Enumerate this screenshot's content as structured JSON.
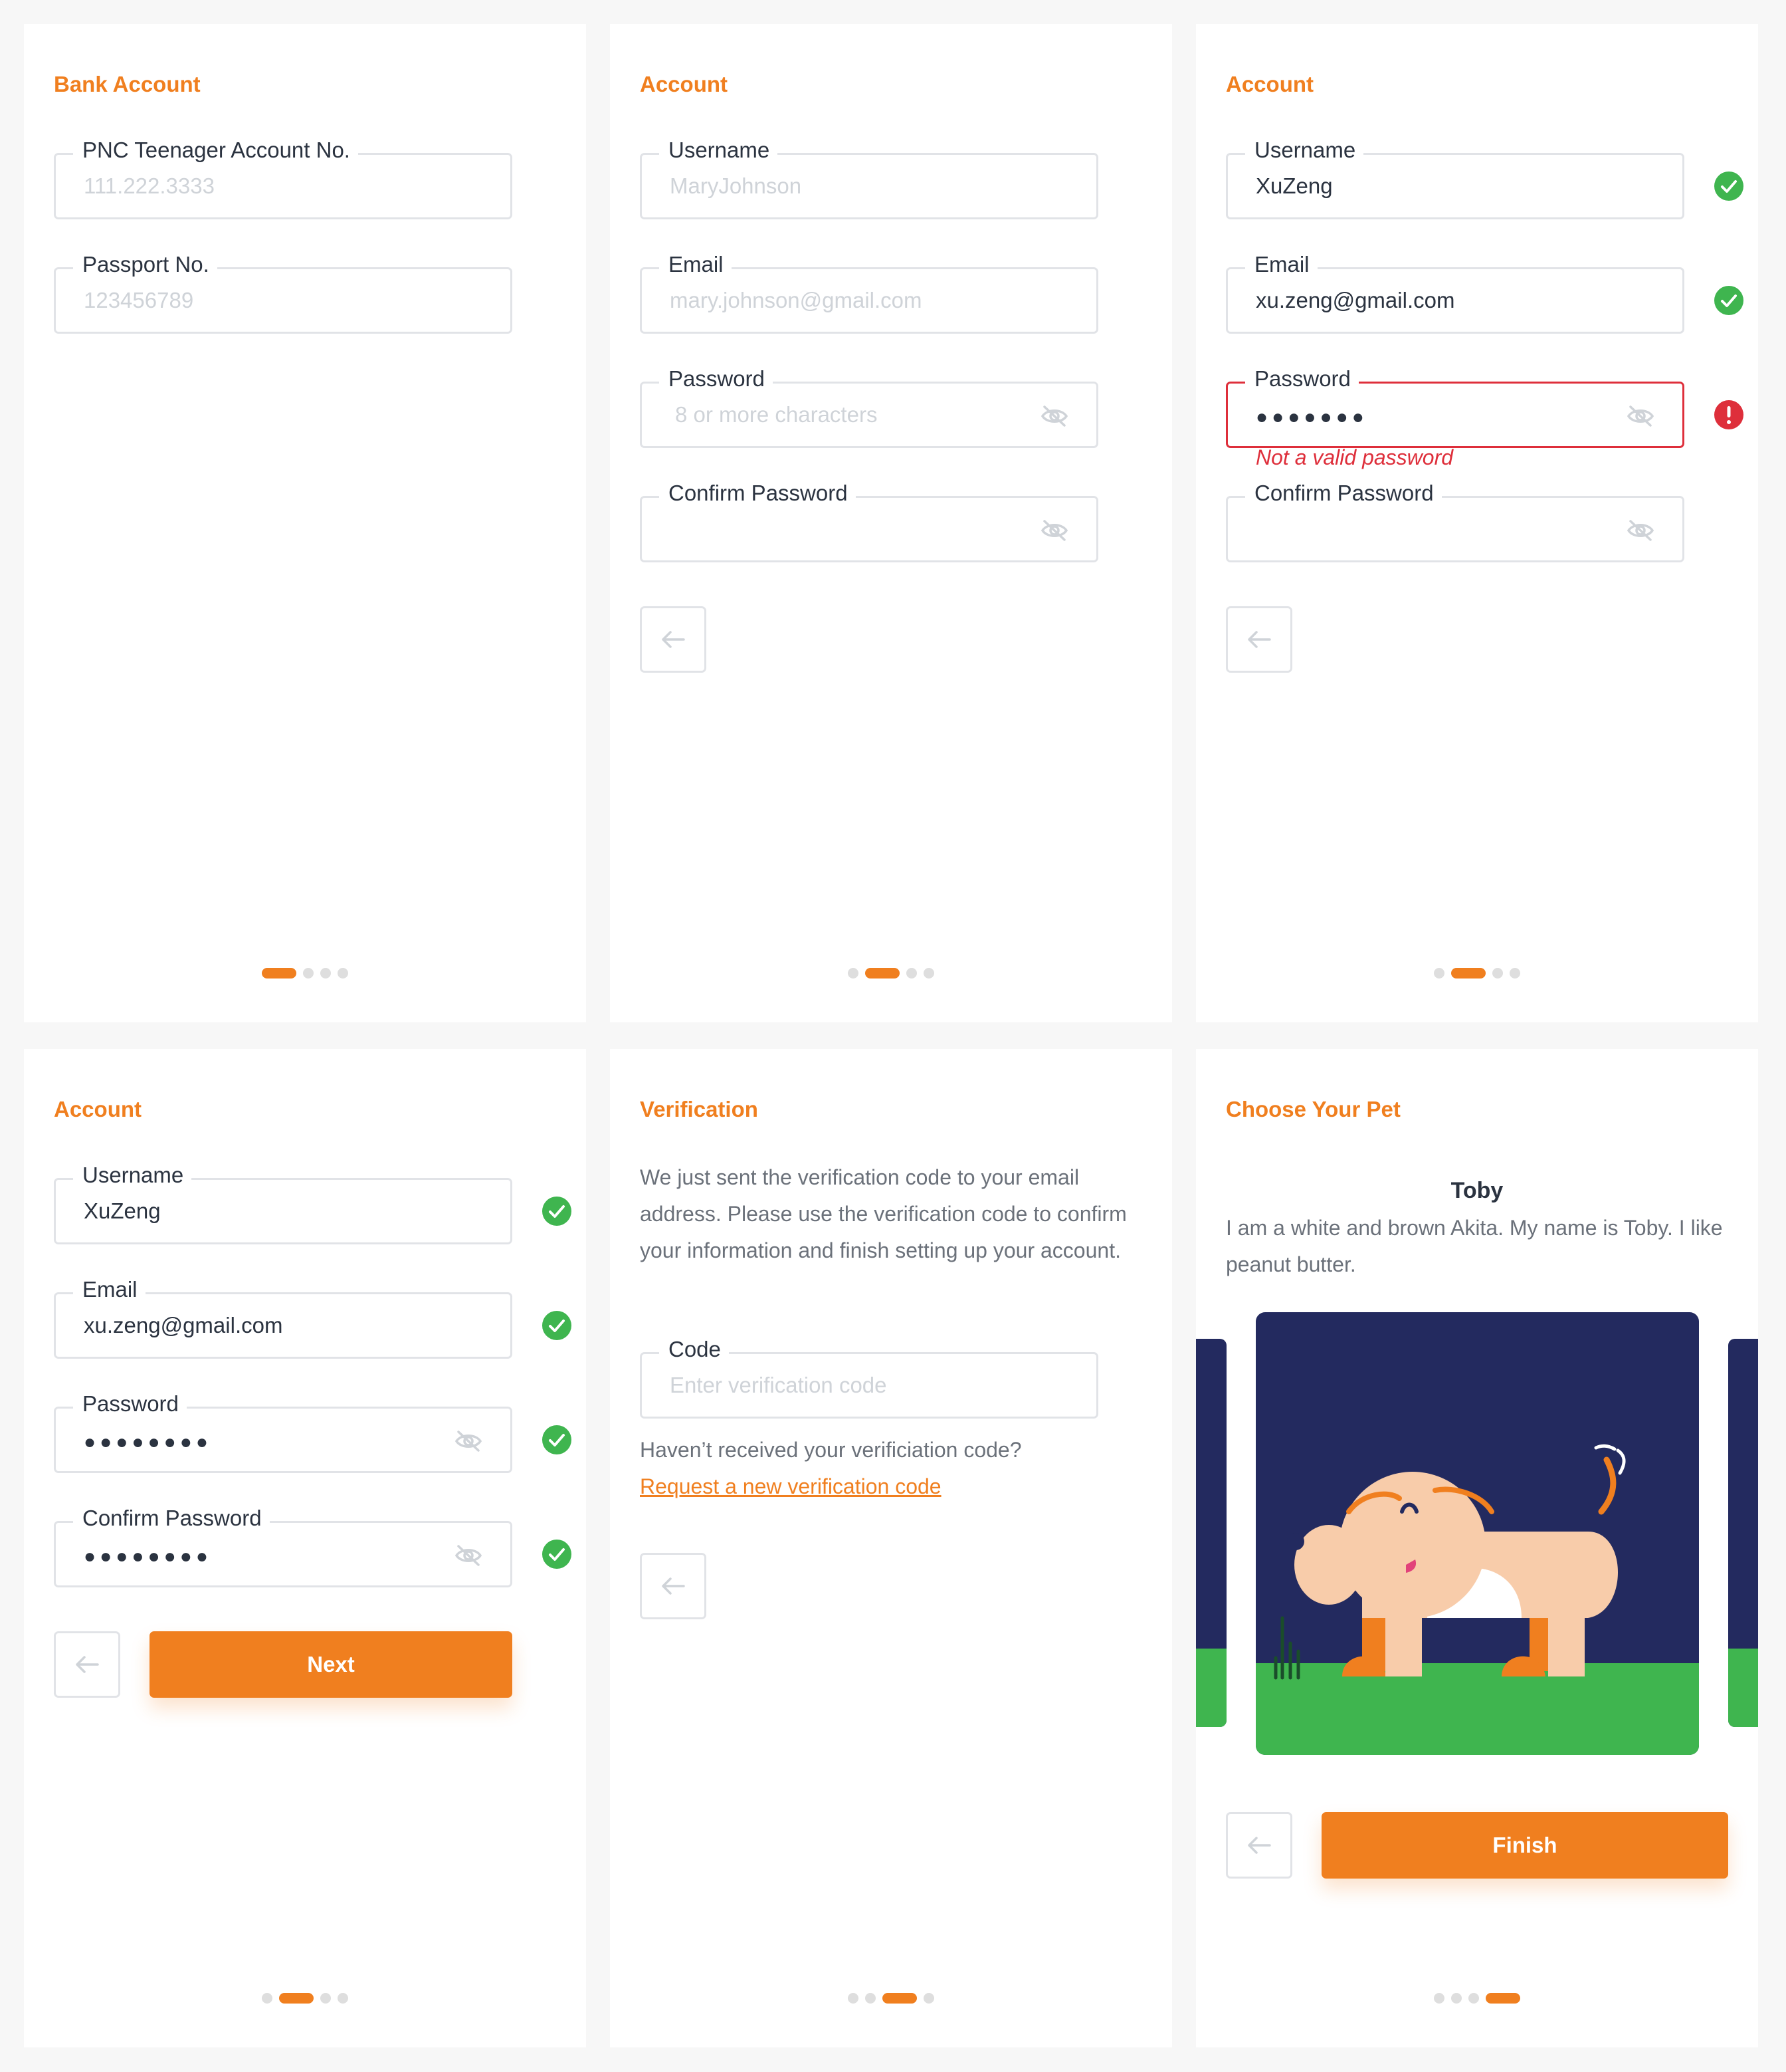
{
  "colors": {
    "accent": "#f07f1f",
    "success": "#3fb54f",
    "error": "#de2f3b",
    "navy": "#232a5f",
    "grass": "#3fb54f",
    "dog": "#f8ccaa"
  },
  "icons": {
    "eye": "eye-off-icon",
    "success": "check-circle-icon",
    "error": "alert-circle-icon",
    "back": "arrow-left-icon"
  },
  "screen1": {
    "title": "Bank Account",
    "account_label": "PNC Teenager Account No.",
    "account_placeholder": "111.222.3333",
    "passport_label": "Passport No.",
    "passport_placeholder": "123456789",
    "pager_active": 1
  },
  "screen2": {
    "title": "Account",
    "username_label": "Username",
    "username_placeholder": "MaryJohnson",
    "email_label": "Email",
    "email_placeholder": "mary.johnson@gmail.com",
    "password_label": "Password",
    "password_placeholder": "8 or more characters",
    "confirm_label": "Confirm Password",
    "confirm_value": "",
    "pager_active": 2
  },
  "screen3": {
    "title": "Account",
    "username_label": "Username",
    "username_value": "XuZeng",
    "email_label": "Email",
    "email_value": "xu.zeng@gmail.com",
    "password_label": "Password",
    "password_value": "●●●●●●●",
    "error_message": "Not a valid password",
    "confirm_label": "Confirm Password",
    "confirm_value": "",
    "pager_active": 2
  },
  "screen4": {
    "title": "Account",
    "username_label": "Username",
    "username_value": "XuZeng",
    "email_label": "Email",
    "email_value": "xu.zeng@gmail.com",
    "password_label": "Password",
    "password_value": "●●●●●●●●",
    "confirm_label": "Confirm Password",
    "confirm_value": "●●●●●●●●",
    "next_label": "Next",
    "pager_active": 2
  },
  "screen5": {
    "title": "Verification",
    "instructions": "We just sent the verification code to your email address. Please use the verification code to confirm your information and finish setting up your account.",
    "code_label": "Code",
    "code_placeholder": "Enter verification code",
    "resend_prompt": "Haven’t received your verificiation code?",
    "resend_link": "Request a new verification code",
    "pager_active": 3
  },
  "screen6": {
    "title": "Choose Your Pet",
    "pet_name": "Toby",
    "pet_description": "I am a white and brown Akita.  My name is Toby. I like peanut butter.",
    "finish_label": "Finish",
    "pager_active": 4
  }
}
